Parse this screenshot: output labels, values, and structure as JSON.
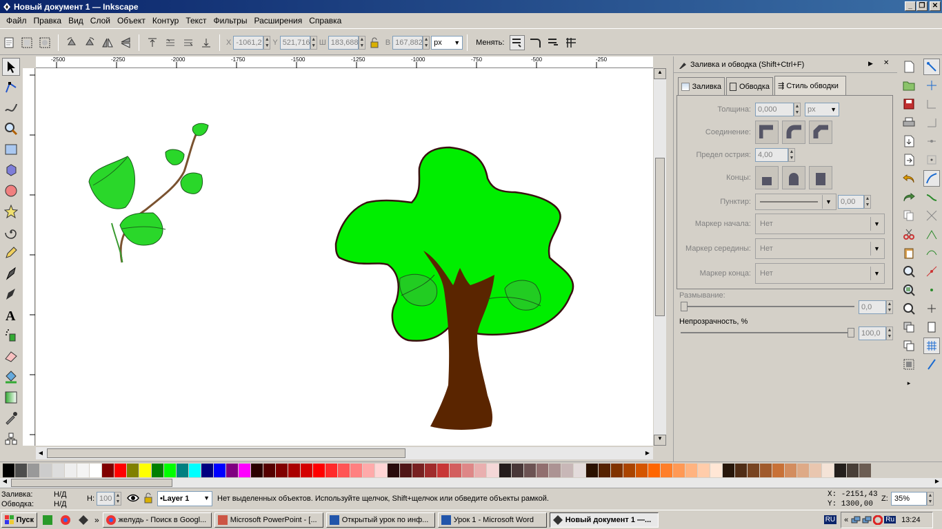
{
  "window": {
    "title": "Новый документ 1 — Inkscape"
  },
  "menu": [
    "Файл",
    "Правка",
    "Вид",
    "Слой",
    "Объект",
    "Контур",
    "Текст",
    "Фильтры",
    "Расширения",
    "Справка"
  ],
  "toolbar": {
    "x_label": "X",
    "x_value": "-1061,2",
    "y_label": "Y",
    "y_value": "521,716",
    "w_label": "Ш",
    "w_value": "183,688",
    "h_label": "В",
    "h_value": "167,882",
    "unit": "px",
    "change_label": "Менять:"
  },
  "ruler": {
    "h_ticks": [
      "-2500",
      "-2250",
      "-2000",
      "-1750",
      "-1500",
      "-1250",
      "-1000",
      "-750",
      "-500",
      "-250"
    ]
  },
  "dialog": {
    "title": "Заливка и обводка (Shift+Ctrl+F)",
    "tabs": [
      "Заливка",
      "Обводка",
      "Стиль обводки"
    ],
    "width_label": "Толщина:",
    "width_value": "0,000",
    "width_unit": "px",
    "join_label": "Соединение:",
    "miter_label": "Предел острия:",
    "miter_value": "4,00",
    "cap_label": "Концы:",
    "dash_label": "Пунктир:",
    "dash_value": "0,00",
    "marker_start_label": "Маркер начала:",
    "marker_start_value": "Нет",
    "marker_mid_label": "Маркер середины:",
    "marker_mid_value": "Нет",
    "marker_end_label": "Маркер конца:",
    "marker_end_value": "Нет",
    "blur_label": "Размывание:",
    "blur_value": "0,0",
    "opacity_label": "Непрозрачность, %",
    "opacity_value": "100,0"
  },
  "palette": [
    "#000000",
    "#4d4d4d",
    "#999999",
    "#cccccc",
    "#dddddd",
    "#eeeeee",
    "#f4f4f4",
    "#ffffff",
    "#800000",
    "#ff0000",
    "#808000",
    "#ffff00",
    "#008000",
    "#00ff00",
    "#008080",
    "#00ffff",
    "#000080",
    "#0000ff",
    "#800080",
    "#ff00ff",
    "#2b0000",
    "#550000",
    "#800000",
    "#aa0000",
    "#d40000",
    "#ff0000",
    "#ff2a2a",
    "#ff5555",
    "#ff8080",
    "#ffaaaa",
    "#ffd5d5",
    "#280b0b",
    "#501616",
    "#782121",
    "#a02c2c",
    "#c83737",
    "#d35f5f",
    "#de8787",
    "#e9afaf",
    "#f4d7d7",
    "#241c1c",
    "#483737",
    "#6c5353",
    "#916f6f",
    "#ac9393",
    "#c8b7b7",
    "#e3dbdb",
    "#2b1100",
    "#552200",
    "#803300",
    "#aa4400",
    "#d45500",
    "#ff6600",
    "#ff7f2a",
    "#ff9955",
    "#ffb380",
    "#ffccaa",
    "#ffe6d5",
    "#28170b",
    "#502d16",
    "#784421",
    "#a05a2c",
    "#c87137",
    "#d38d5f",
    "#deaa87",
    "#e9c6af",
    "#f4e3d7",
    "#241f1c",
    "#483e37",
    "#6c5d53"
  ],
  "status": {
    "fill_label": "Заливка:",
    "fill_value": "Н/Д",
    "stroke_label": "Обводка:",
    "stroke_value": "Н/Д",
    "h_label": "Н:",
    "h_value": "100",
    "layer": "•Layer 1",
    "message": "Нет выделенных объектов. Используйте щелчок, Shift+щелчок или обведите объекты рамкой.",
    "x_coord": "X: -2151,43",
    "y_coord": "Y:  1300,00",
    "zoom_label": "Z:",
    "zoom_value": "35%"
  },
  "taskbar": {
    "start": "Пуск",
    "tasks": [
      "желудь - Поиск в Googl...",
      "Microsoft PowerPoint - [...",
      "Открытый урок по инф...",
      "Урок 1 - Microsoft Word",
      "Новый документ 1 —..."
    ],
    "lang": "RU",
    "lang2": "Ru",
    "clock": "13:24"
  }
}
